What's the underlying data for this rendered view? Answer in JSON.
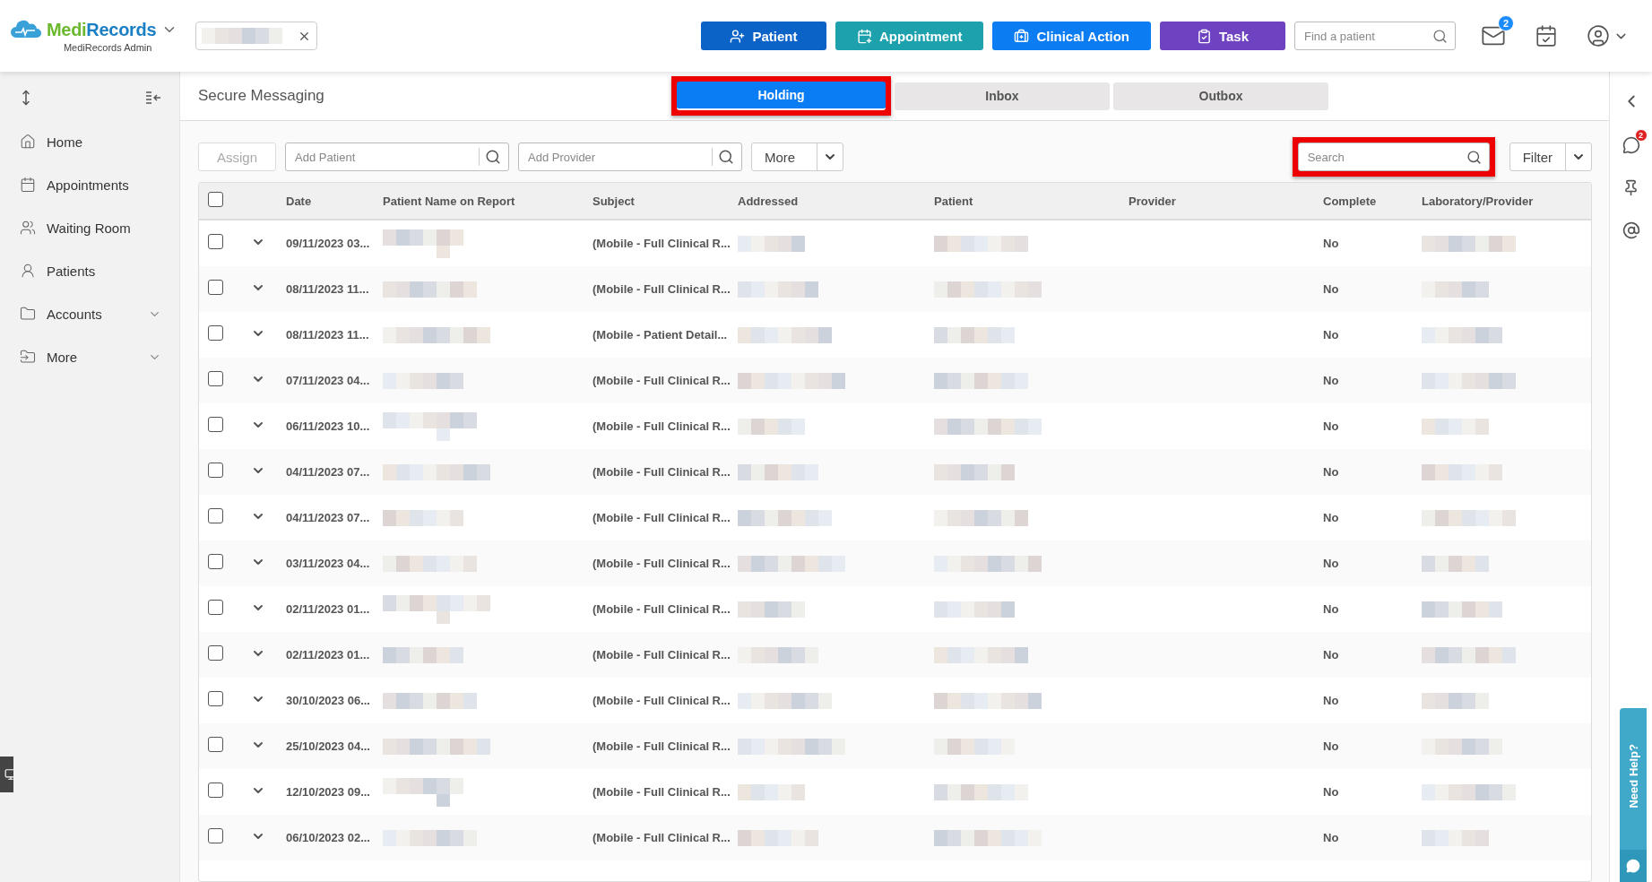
{
  "app": {
    "logo_first": "Medi",
    "logo_second": "Records",
    "subtitle": "MediRecords Admin"
  },
  "actions": [
    {
      "kind": "patient",
      "label": "Patient",
      "color": "#0b63c8"
    },
    {
      "kind": "appointment",
      "label": "Appointment",
      "color": "#1ca1ad"
    },
    {
      "kind": "clinical",
      "label": "Clinical Action",
      "color": "#0b7cf2"
    },
    {
      "kind": "task",
      "label": "Task",
      "color": "#6f42c1"
    }
  ],
  "patient_search": {
    "placeholder": "Find a patient"
  },
  "mail_badge": "2",
  "sidebar": {
    "items": [
      {
        "kind": "home",
        "label": "Home"
      },
      {
        "kind": "appointments",
        "label": "Appointments"
      },
      {
        "kind": "waiting",
        "label": "Waiting Room"
      },
      {
        "kind": "patients",
        "label": "Patients"
      },
      {
        "kind": "accounts",
        "label": "Accounts",
        "expanded": false
      },
      {
        "kind": "more",
        "label": "More",
        "expanded": false
      }
    ]
  },
  "page_title": "Secure Messaging",
  "tabs": [
    {
      "label": "Holding",
      "selected": true,
      "highlighted": true
    },
    {
      "label": "Inbox",
      "selected": false,
      "highlighted": false
    },
    {
      "label": "Outbox",
      "selected": false,
      "highlighted": false
    }
  ],
  "toolbar": {
    "assign": {
      "label": "Assign",
      "disabled": true
    },
    "add_patient": {
      "placeholder": "Add Patient"
    },
    "add_provider": {
      "placeholder": "Add Provider"
    },
    "more": "More",
    "search": {
      "placeholder": "Search",
      "highlighted": true
    },
    "filter": "Filter"
  },
  "table": {
    "all_checked": false,
    "columns": [
      "Date",
      "Patient Name on Report",
      "Subject",
      "Addressed",
      "Patient",
      "Provider",
      "Complete",
      "Laboratory/Provider"
    ],
    "rows": [
      {
        "date": "09/11/2023 03...",
        "subject": "(Mobile - Full Clinical R...",
        "complete": "No",
        "checked": false
      },
      {
        "date": "08/11/2023 11...",
        "subject": "(Mobile - Full Clinical R...",
        "complete": "No",
        "checked": false
      },
      {
        "date": "08/11/2023 11...",
        "subject": "(Mobile - Patient Detail...",
        "complete": "No",
        "checked": false
      },
      {
        "date": "07/11/2023 04...",
        "subject": "(Mobile - Full Clinical R...",
        "complete": "No",
        "checked": false
      },
      {
        "date": "06/11/2023 10...",
        "subject": "(Mobile - Full Clinical R...",
        "complete": "No",
        "checked": false
      },
      {
        "date": "04/11/2023 07...",
        "subject": "(Mobile - Full Clinical R...",
        "complete": "No",
        "checked": false
      },
      {
        "date": "04/11/2023 07...",
        "subject": "(Mobile - Full Clinical R...",
        "complete": "No",
        "checked": false
      },
      {
        "date": "03/11/2023 04...",
        "subject": "(Mobile - Full Clinical R...",
        "complete": "No",
        "checked": false
      },
      {
        "date": "02/11/2023 01...",
        "subject": "(Mobile - Full Clinical R...",
        "complete": "No",
        "checked": false
      },
      {
        "date": "02/11/2023 01...",
        "subject": "(Mobile - Full Clinical R...",
        "complete": "No",
        "checked": false
      },
      {
        "date": "30/10/2023 06...",
        "subject": "(Mobile - Full Clinical R...",
        "complete": "No",
        "checked": false
      },
      {
        "date": "25/10/2023 04...",
        "subject": "(Mobile - Full Clinical R...",
        "complete": "No",
        "checked": false
      },
      {
        "date": "12/10/2023 09...",
        "subject": "(Mobile - Full Clinical R...",
        "complete": "No",
        "checked": false
      },
      {
        "date": "06/10/2023 02...",
        "subject": "(Mobile - Full Clinical R...",
        "complete": "No",
        "checked": false
      }
    ]
  },
  "right_rail": {
    "chat_badge": "2"
  },
  "help": "Need Help?"
}
